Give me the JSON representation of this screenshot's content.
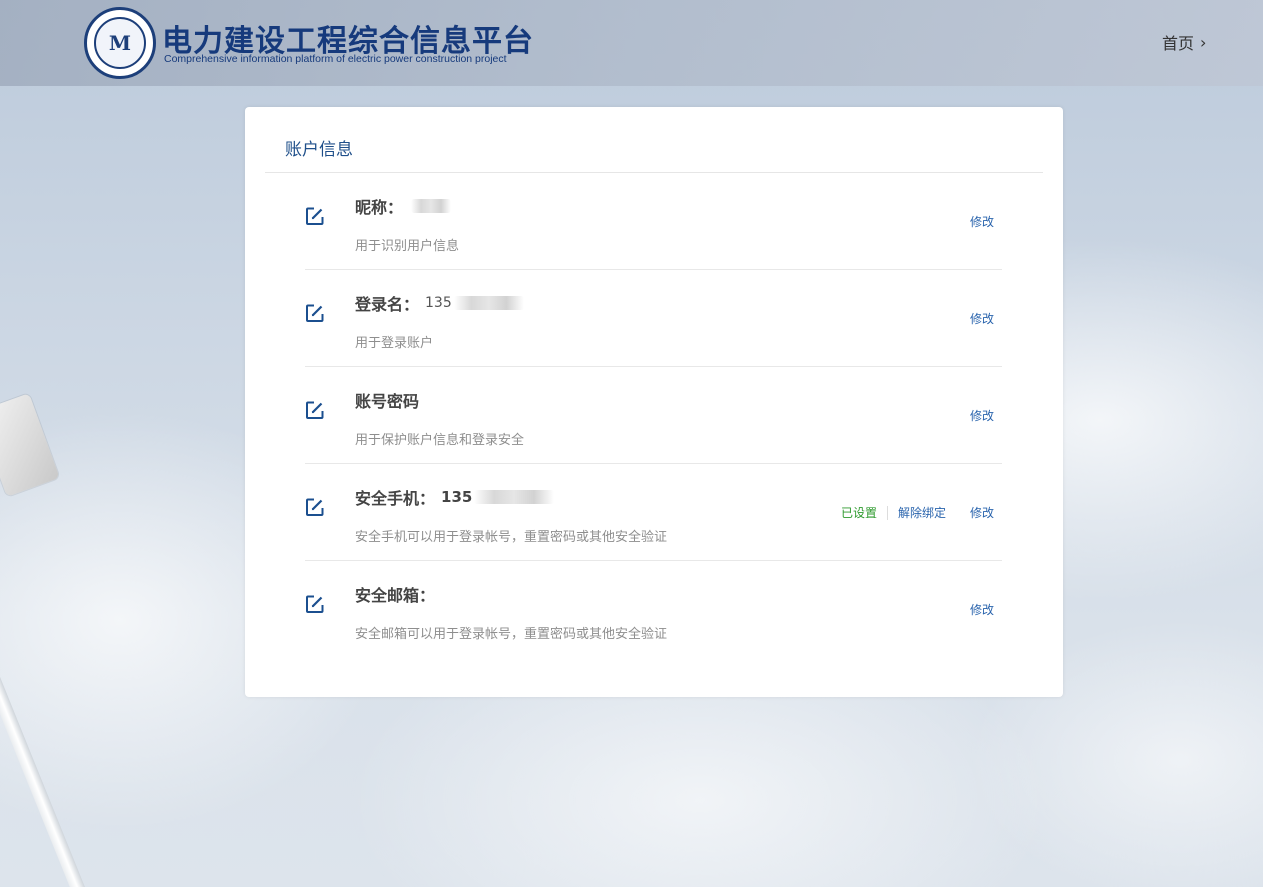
{
  "header": {
    "title_cn": "电力建设工程综合信息平台",
    "title_en": "Comprehensive information platform of electric power construction project",
    "home_label": "首页",
    "logo_mark": "M"
  },
  "card": {
    "title": "账户信息",
    "rows": [
      {
        "label": "昵称：",
        "value": "",
        "description": "用于识别用户信息",
        "actions": {
          "modify": "修改"
        }
      },
      {
        "label": "登录名：",
        "value": "135",
        "description": "用于登录账户",
        "actions": {
          "modify": "修改"
        }
      },
      {
        "label": "账号密码",
        "value": "",
        "description": "用于保护账户信息和登录安全",
        "actions": {
          "modify": "修改"
        }
      },
      {
        "label": "安全手机：",
        "value": "135",
        "description": "安全手机可以用于登录帐号，重置密码或其他安全验证",
        "actions": {
          "status": "已设置",
          "unbind": "解除绑定",
          "modify": "修改"
        }
      },
      {
        "label": "安全邮箱：",
        "value": "",
        "description": "安全邮箱可以用于登录帐号，重置密码或其他安全验证",
        "actions": {
          "modify": "修改"
        }
      }
    ]
  },
  "icons": {
    "edit": "edit-icon",
    "home_chevron": "chevron-right-icon"
  },
  "colors": {
    "brand": "#163a7c",
    "link": "#2a64ad",
    "status_ok": "#2e9a2e"
  }
}
